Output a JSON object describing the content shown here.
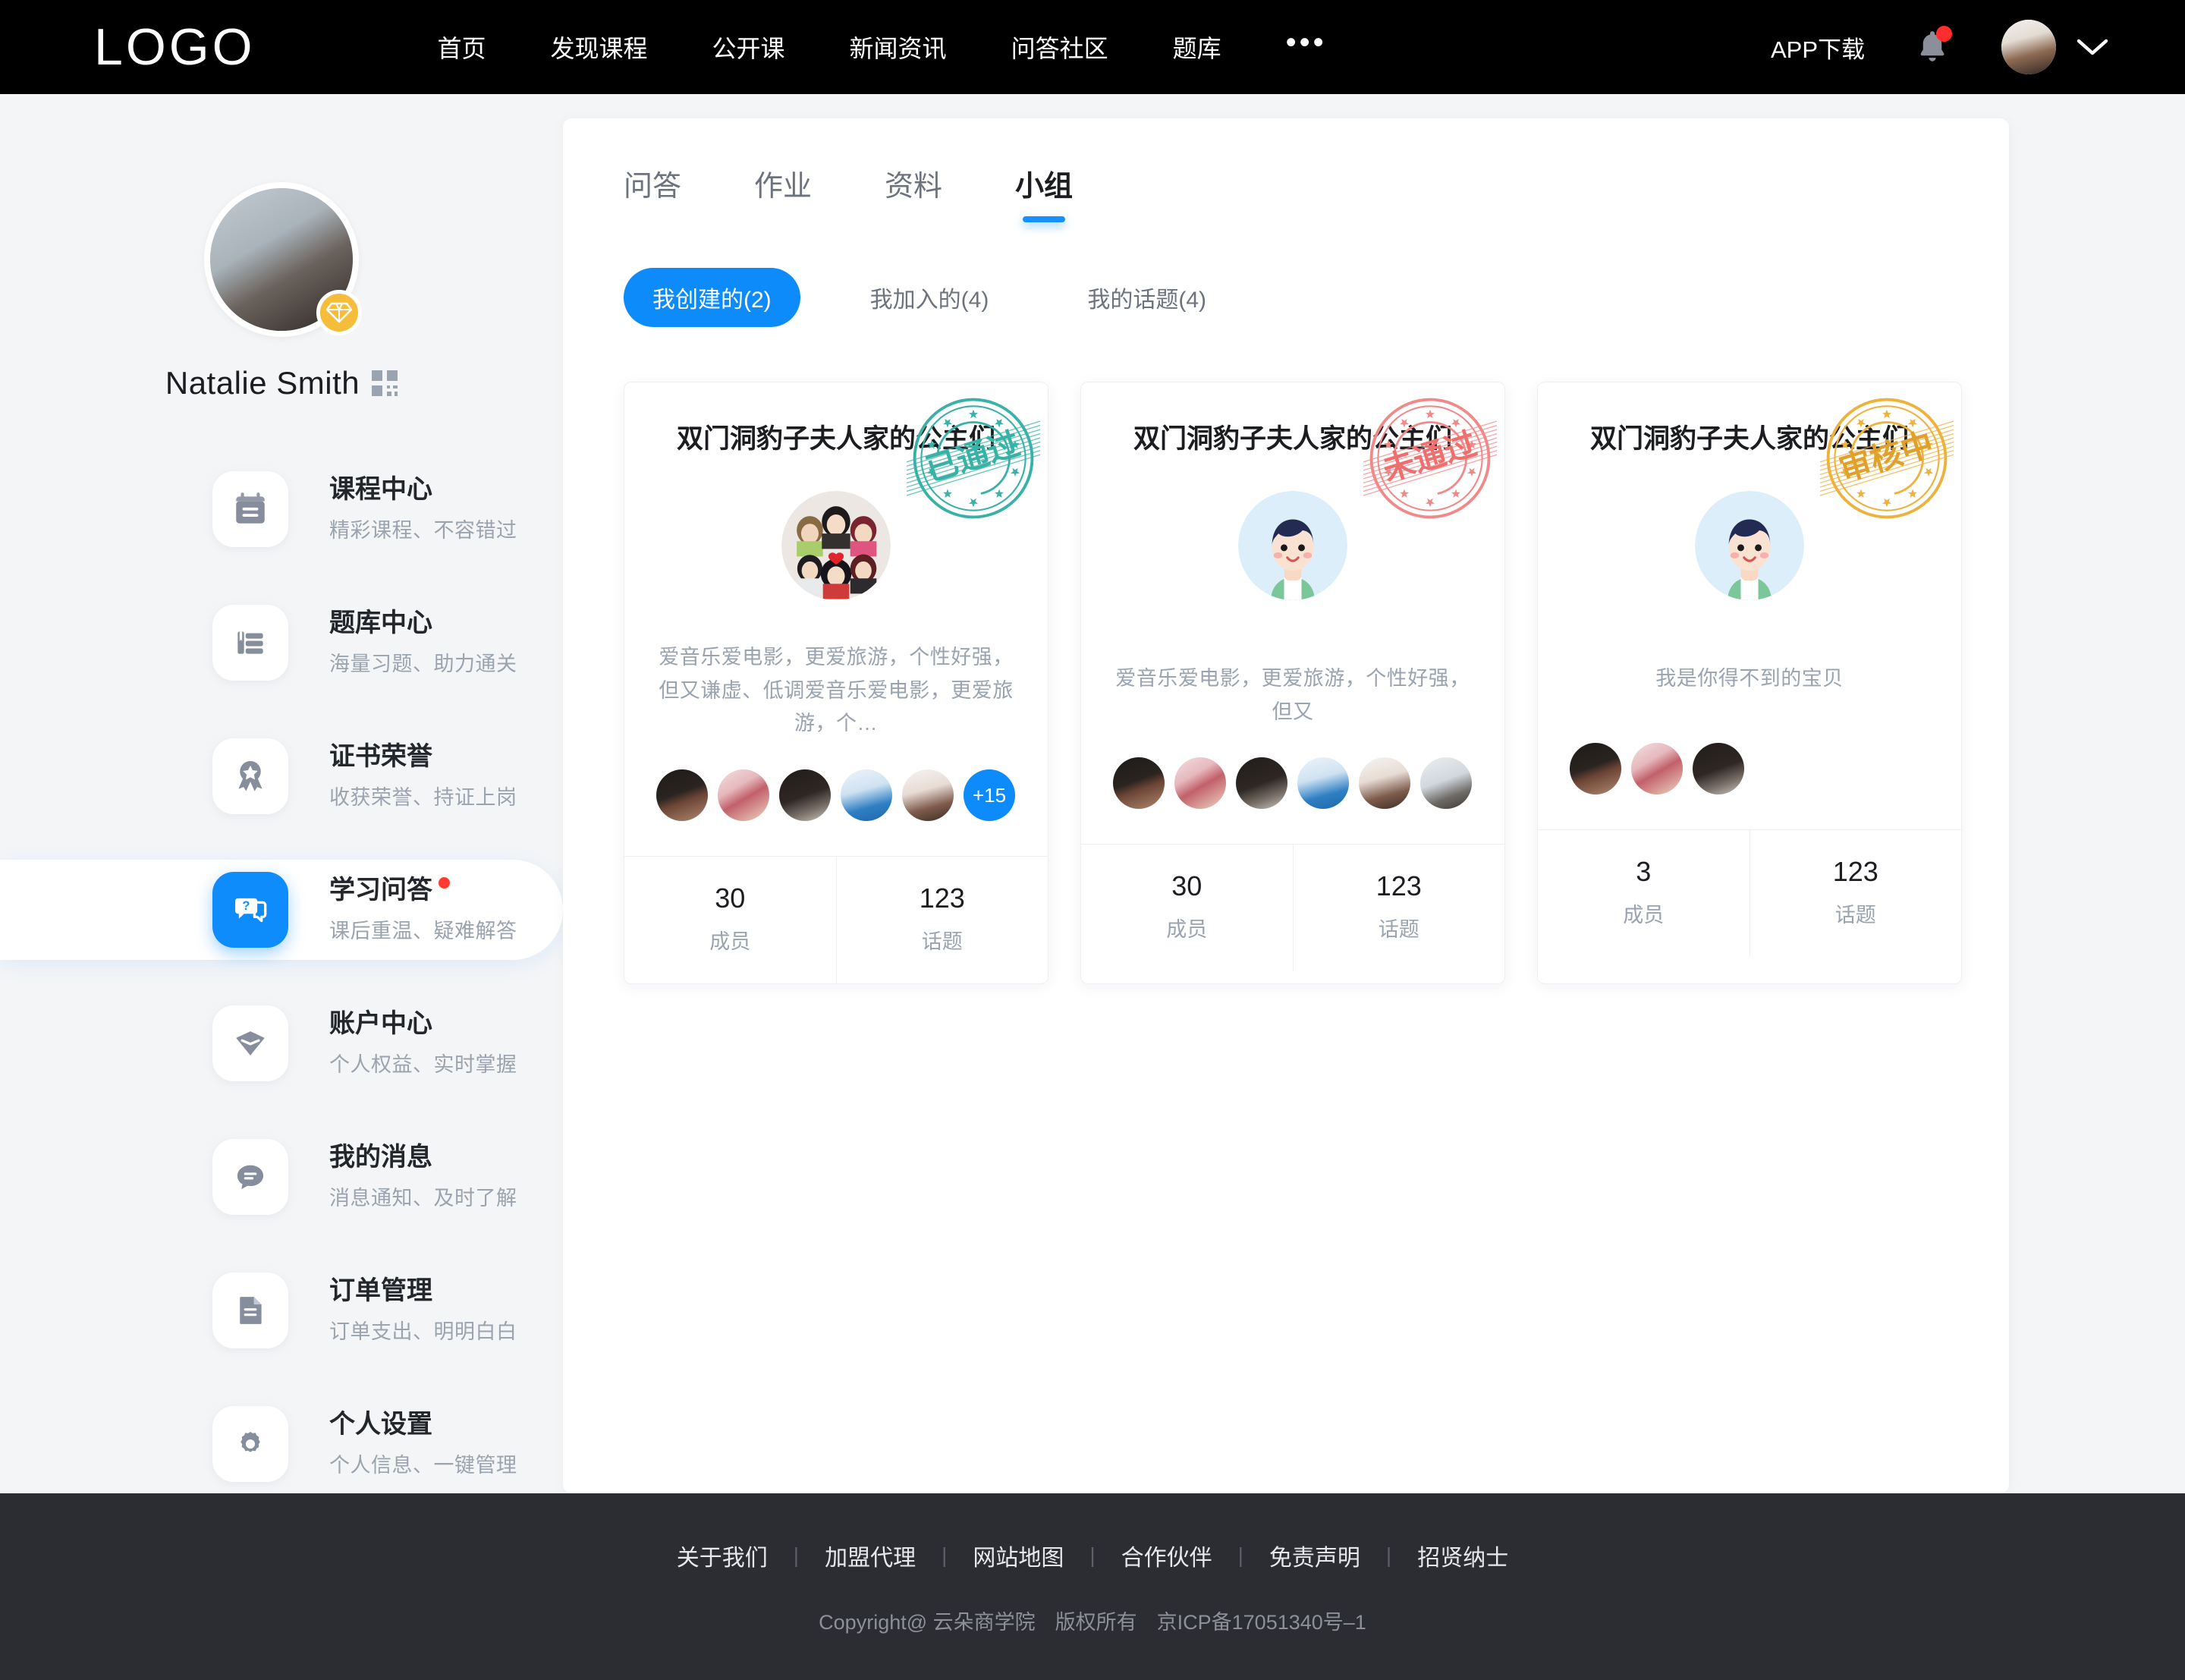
{
  "header": {
    "logo": "LOGO",
    "nav": [
      {
        "label": "首页"
      },
      {
        "label": "发现课程"
      },
      {
        "label": "公开课"
      },
      {
        "label": "新闻资讯"
      },
      {
        "label": "问答社区"
      },
      {
        "label": "题库"
      }
    ],
    "more_icon": "more-horizontal-icon",
    "app_download": "APP下载",
    "bell_icon": "bell-icon",
    "has_notification": true,
    "avatar_icon": "user-avatar",
    "chevron_icon": "chevron-down-icon"
  },
  "sidebar": {
    "user_name": "Natalie Smith",
    "vip_badge_icon": "diamond-icon",
    "qr_icon": "qrcode-icon",
    "items": [
      {
        "title": "课程中心",
        "subtitle": "精彩课程、不容错过",
        "icon": "calendar-icon",
        "active": false,
        "dot": false
      },
      {
        "title": "题库中心",
        "subtitle": "海量习题、助力通关",
        "icon": "book-list-icon",
        "active": false,
        "dot": false
      },
      {
        "title": "证书荣誉",
        "subtitle": "收获荣誉、持证上岗",
        "icon": "medal-icon",
        "active": false,
        "dot": false
      },
      {
        "title": "学习问答",
        "subtitle": "课后重温、疑难解答",
        "icon": "qa-chat-icon",
        "active": true,
        "dot": true
      },
      {
        "title": "账户中心",
        "subtitle": "个人权益、实时掌握",
        "icon": "diamond-icon",
        "active": false,
        "dot": false
      },
      {
        "title": "我的消息",
        "subtitle": "消息通知、及时了解",
        "icon": "message-icon",
        "active": false,
        "dot": false
      },
      {
        "title": "订单管理",
        "subtitle": "订单支出、明明白白",
        "icon": "document-icon",
        "active": false,
        "dot": false
      },
      {
        "title": "个人设置",
        "subtitle": "个人信息、一键管理",
        "icon": "gear-icon",
        "active": false,
        "dot": false
      }
    ]
  },
  "main": {
    "tabs": [
      {
        "label": "问答",
        "active": false
      },
      {
        "label": "作业",
        "active": false
      },
      {
        "label": "资料",
        "active": false
      },
      {
        "label": "小组",
        "active": true
      }
    ],
    "pills": [
      {
        "label": "我创建的(2)",
        "active": true
      },
      {
        "label": "我加入的(4)",
        "active": false
      },
      {
        "label": "我的话题(4)",
        "active": false
      }
    ],
    "cards": [
      {
        "title": "双门洞豹子夫人家的公主们",
        "stamp_text": "已通过",
        "stamp_color": "#38b2a6",
        "avatar_icon": "group-collage-avatar",
        "description": "爱音乐爱电影，更爱旅游，个性好强，但又谦虚、低调爱音乐爱电影，更爱旅游，个…",
        "members_shown": 5,
        "members_more": "+15",
        "stats": [
          {
            "value": "30",
            "label": "成员"
          },
          {
            "value": "123",
            "label": "话题"
          }
        ]
      },
      {
        "title": "双门洞豹子夫人家的公主们",
        "stamp_text": "未通过",
        "stamp_color": "#f08a8a",
        "avatar_icon": "boy-cartoon-avatar",
        "description": "爱音乐爱电影，更爱旅游，个性好强，但又",
        "members_shown": 6,
        "members_more": "",
        "stats": [
          {
            "value": "30",
            "label": "成员"
          },
          {
            "value": "123",
            "label": "话题"
          }
        ]
      },
      {
        "title": "双门洞豹子夫人家的公主们",
        "stamp_text": "审核中",
        "stamp_color": "#eeb13c",
        "avatar_icon": "boy-cartoon-avatar",
        "description": "我是你得不到的宝贝",
        "members_shown": 3,
        "members_more": "",
        "stats": [
          {
            "value": "3",
            "label": "成员"
          },
          {
            "value": "123",
            "label": "话题"
          }
        ]
      }
    ]
  },
  "footer": {
    "links": [
      {
        "label": "关于我们"
      },
      {
        "label": "加盟代理"
      },
      {
        "label": "网站地图"
      },
      {
        "label": "合作伙伴"
      },
      {
        "label": "免责声明"
      },
      {
        "label": "招贤纳士"
      }
    ],
    "copyright": "Copyright@ 云朵商学院",
    "rights": "版权所有",
    "icp": "京ICP备17051340号–1"
  },
  "colors": {
    "accent_blue": "#0d8bfb",
    "tab_underline": "#1890ff",
    "header_bg": "#000000",
    "page_bg": "#f4f5f7",
    "footer_bg": "#2b2d33",
    "vip_gold": "#f6bd3b",
    "notification_red": "#ff3b30"
  }
}
